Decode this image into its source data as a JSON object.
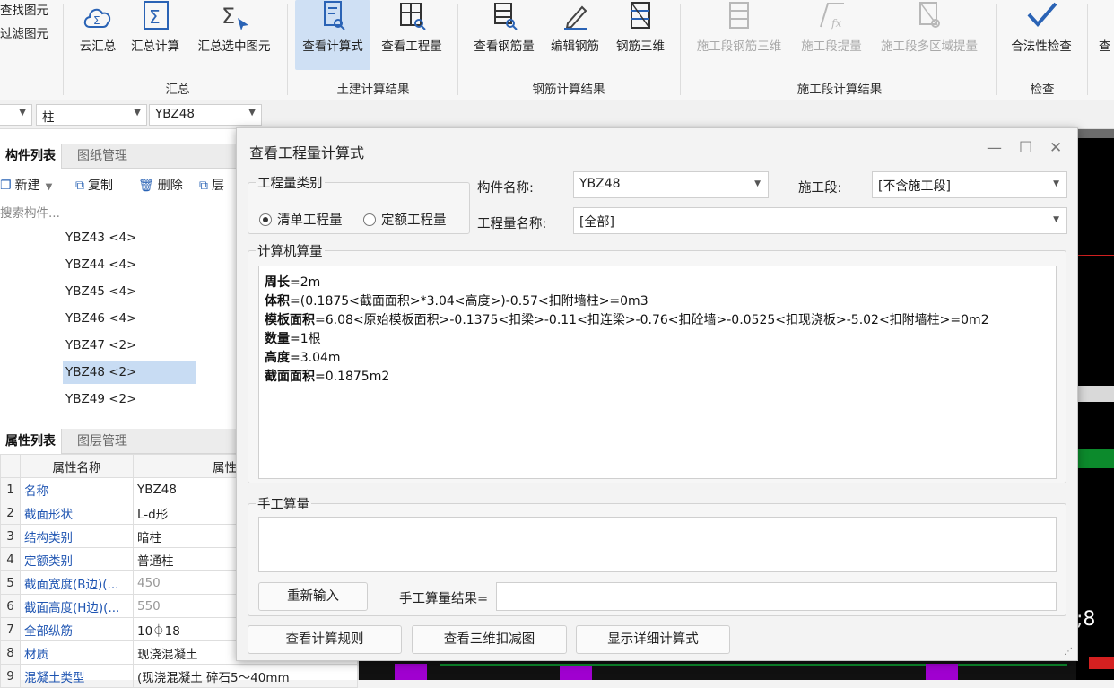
{
  "ribbon": {
    "left": {
      "find": "查找图元",
      "filter": "过滤图元"
    },
    "buttons": {
      "cloud_sum": "云汇总",
      "sum_calc": "汇总计算",
      "sum_selected": "汇总选中图元",
      "view_formula": "查看计算式",
      "view_quantity": "查看工程量",
      "view_rebar_qty": "查看钢筋量",
      "edit_rebar": "编辑钢筋",
      "rebar_3d": "钢筋三维",
      "seg_rebar_3d": "施工段钢筋三维",
      "seg_extract": "施工段提量",
      "seg_multi_extract": "施工段多区域提量",
      "legality_check": "合法性检查",
      "more": "查"
    },
    "groups": {
      "summary": "汇总",
      "civil": "土建计算结果",
      "rebar": "钢筋计算结果",
      "segment": "施工段计算结果",
      "check": "检查"
    },
    "accent": "#2a63b5",
    "active_bg": "#cfe0f4"
  },
  "filterbar": {
    "type_value": "柱",
    "name_value": "YBZ48"
  },
  "left_panel": {
    "tabs": {
      "component_list": "构件列表",
      "drawing_mgmt": "图纸管理"
    },
    "toolbar": {
      "new": "新建",
      "copy": "复制",
      "delete": "删除",
      "layer": "层"
    },
    "search_placeholder": "搜索构件...",
    "items": [
      {
        "label": "YBZ43 <4>"
      },
      {
        "label": "YBZ44 <4>"
      },
      {
        "label": "YBZ45 <4>"
      },
      {
        "label": "YBZ46 <4>"
      },
      {
        "label": "YBZ47 <2>"
      },
      {
        "label": "YBZ48 <2>"
      },
      {
        "label": "YBZ49 <2>"
      }
    ],
    "selected_index": 5,
    "prop_tabs": {
      "props": "属性列表",
      "layer_mgmt": "图层管理"
    },
    "prop_headers": {
      "name": "属性名称",
      "value": "属性"
    },
    "props": [
      {
        "idx": "1",
        "name": "名称",
        "value": "YBZ48"
      },
      {
        "idx": "2",
        "name": "截面形状",
        "value": "L-d形"
      },
      {
        "idx": "3",
        "name": "结构类别",
        "value": "暗柱"
      },
      {
        "idx": "4",
        "name": "定额类别",
        "value": "普通柱"
      },
      {
        "idx": "5",
        "name": "截面宽度(B边)(...",
        "value": "450"
      },
      {
        "idx": "6",
        "name": "截面高度(H边)(...",
        "value": "550"
      },
      {
        "idx": "7",
        "name": "全部纵筋",
        "value": "10⏀18"
      },
      {
        "idx": "8",
        "name": "材质",
        "value": "现浇混凝土"
      },
      {
        "idx": "9",
        "name": "混凝土类型",
        "value": "(现浇混凝土   碎石5～40mm"
      }
    ]
  },
  "dialog": {
    "title": "查看工程量计算式",
    "qty_type": {
      "legend": "工程量类别",
      "bill": "清单工程量",
      "quota": "定额工程量"
    },
    "comp_name_label": "构件名称:",
    "comp_name_value": "YBZ48",
    "segment_label": "施工段:",
    "segment_value": "[不含施工段]",
    "qty_name_label": "工程量名称:",
    "qty_name_value": "[全部]",
    "computer": {
      "legend": "计算机算量",
      "lines": [
        {
          "key": "周长",
          "rest": "=2m"
        },
        {
          "key": "体积",
          "rest": "=(0.1875<截面面积>*3.04<高度>)-0.57<扣附墙柱>=0m3"
        },
        {
          "key": "模板面积",
          "rest": "=6.08<原始模板面积>-0.1375<扣梁>-0.11<扣连梁>-0.76<扣砼墙>-0.0525<扣现浇板>-5.02<扣附墙柱>=0m2"
        },
        {
          "key": "数量",
          "rest": "=1根"
        },
        {
          "key": "高度",
          "rest": "=3.04m"
        },
        {
          "key": "截面面积",
          "rest": "=0.1875m2"
        }
      ]
    },
    "manual": {
      "legend": "手工算量",
      "reinput": "重新输入",
      "result_label": "手工算量结果="
    },
    "footer": {
      "rules": "查看计算规则",
      "deduct3d": "查看三维扣减图",
      "detail": "显示详细计算式"
    }
  },
  "canvas_text": ";8"
}
